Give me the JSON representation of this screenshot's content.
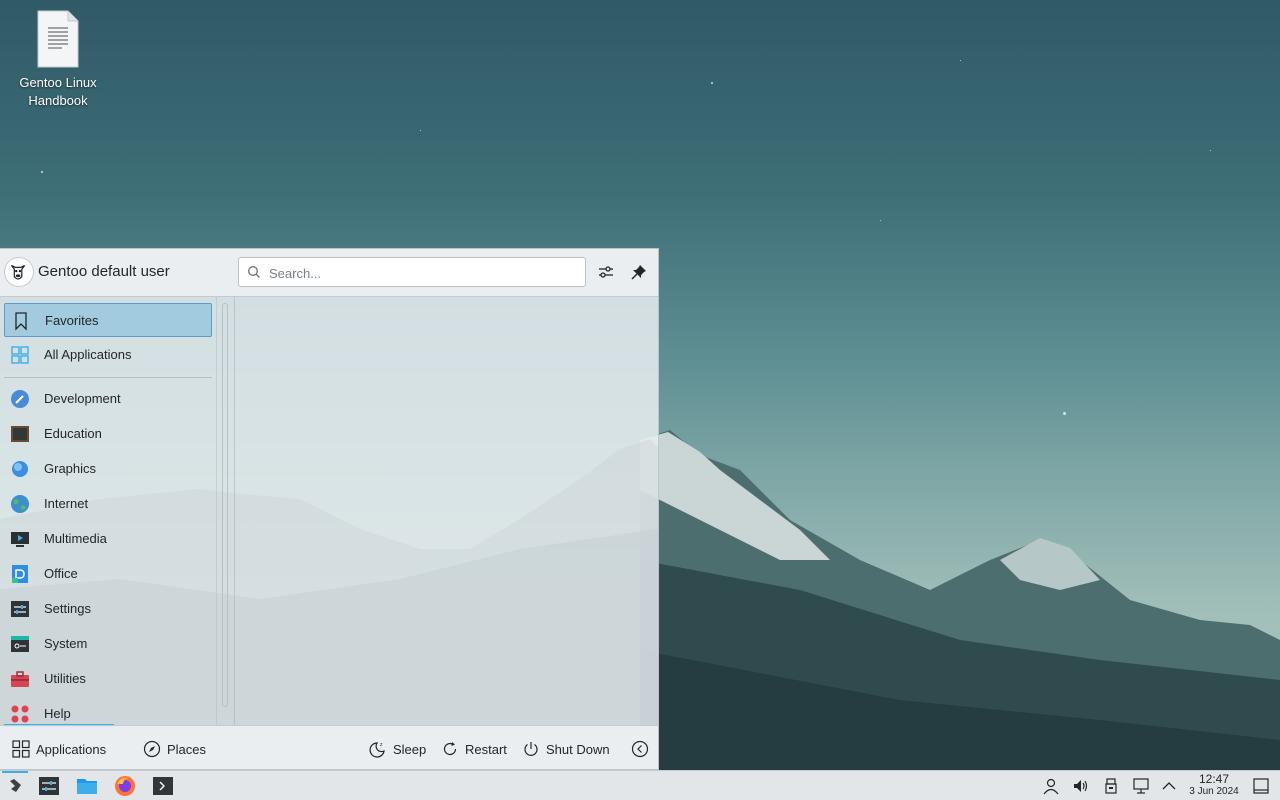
{
  "desktop": {
    "icon_label": "Gentoo Linux Handbook"
  },
  "launcher": {
    "username": "Gentoo default user",
    "search_placeholder": "Search...",
    "categories": [
      {
        "label": "Favorites",
        "icon": "bookmark-icon"
      },
      {
        "label": "All Applications",
        "icon": "grid-icon"
      },
      {
        "label": "Development",
        "icon": "development-icon"
      },
      {
        "label": "Education",
        "icon": "education-icon"
      },
      {
        "label": "Graphics",
        "icon": "graphics-icon"
      },
      {
        "label": "Internet",
        "icon": "internet-icon"
      },
      {
        "label": "Multimedia",
        "icon": "multimedia-icon"
      },
      {
        "label": "Office",
        "icon": "office-icon"
      },
      {
        "label": "Settings",
        "icon": "settings-icon"
      },
      {
        "label": "System",
        "icon": "system-icon"
      },
      {
        "label": "Utilities",
        "icon": "utilities-icon"
      },
      {
        "label": "Help",
        "icon": "help-icon"
      }
    ],
    "footer": {
      "applications": "Applications",
      "places": "Places",
      "sleep": "Sleep",
      "restart": "Restart",
      "shutdown": "Shut Down"
    }
  },
  "taskbar": {
    "time": "12:47",
    "date": "3 Jun 2024"
  },
  "colors": {
    "accent": "#3daee9",
    "selection": "#93c4de",
    "panel": "#e3e6e8"
  }
}
